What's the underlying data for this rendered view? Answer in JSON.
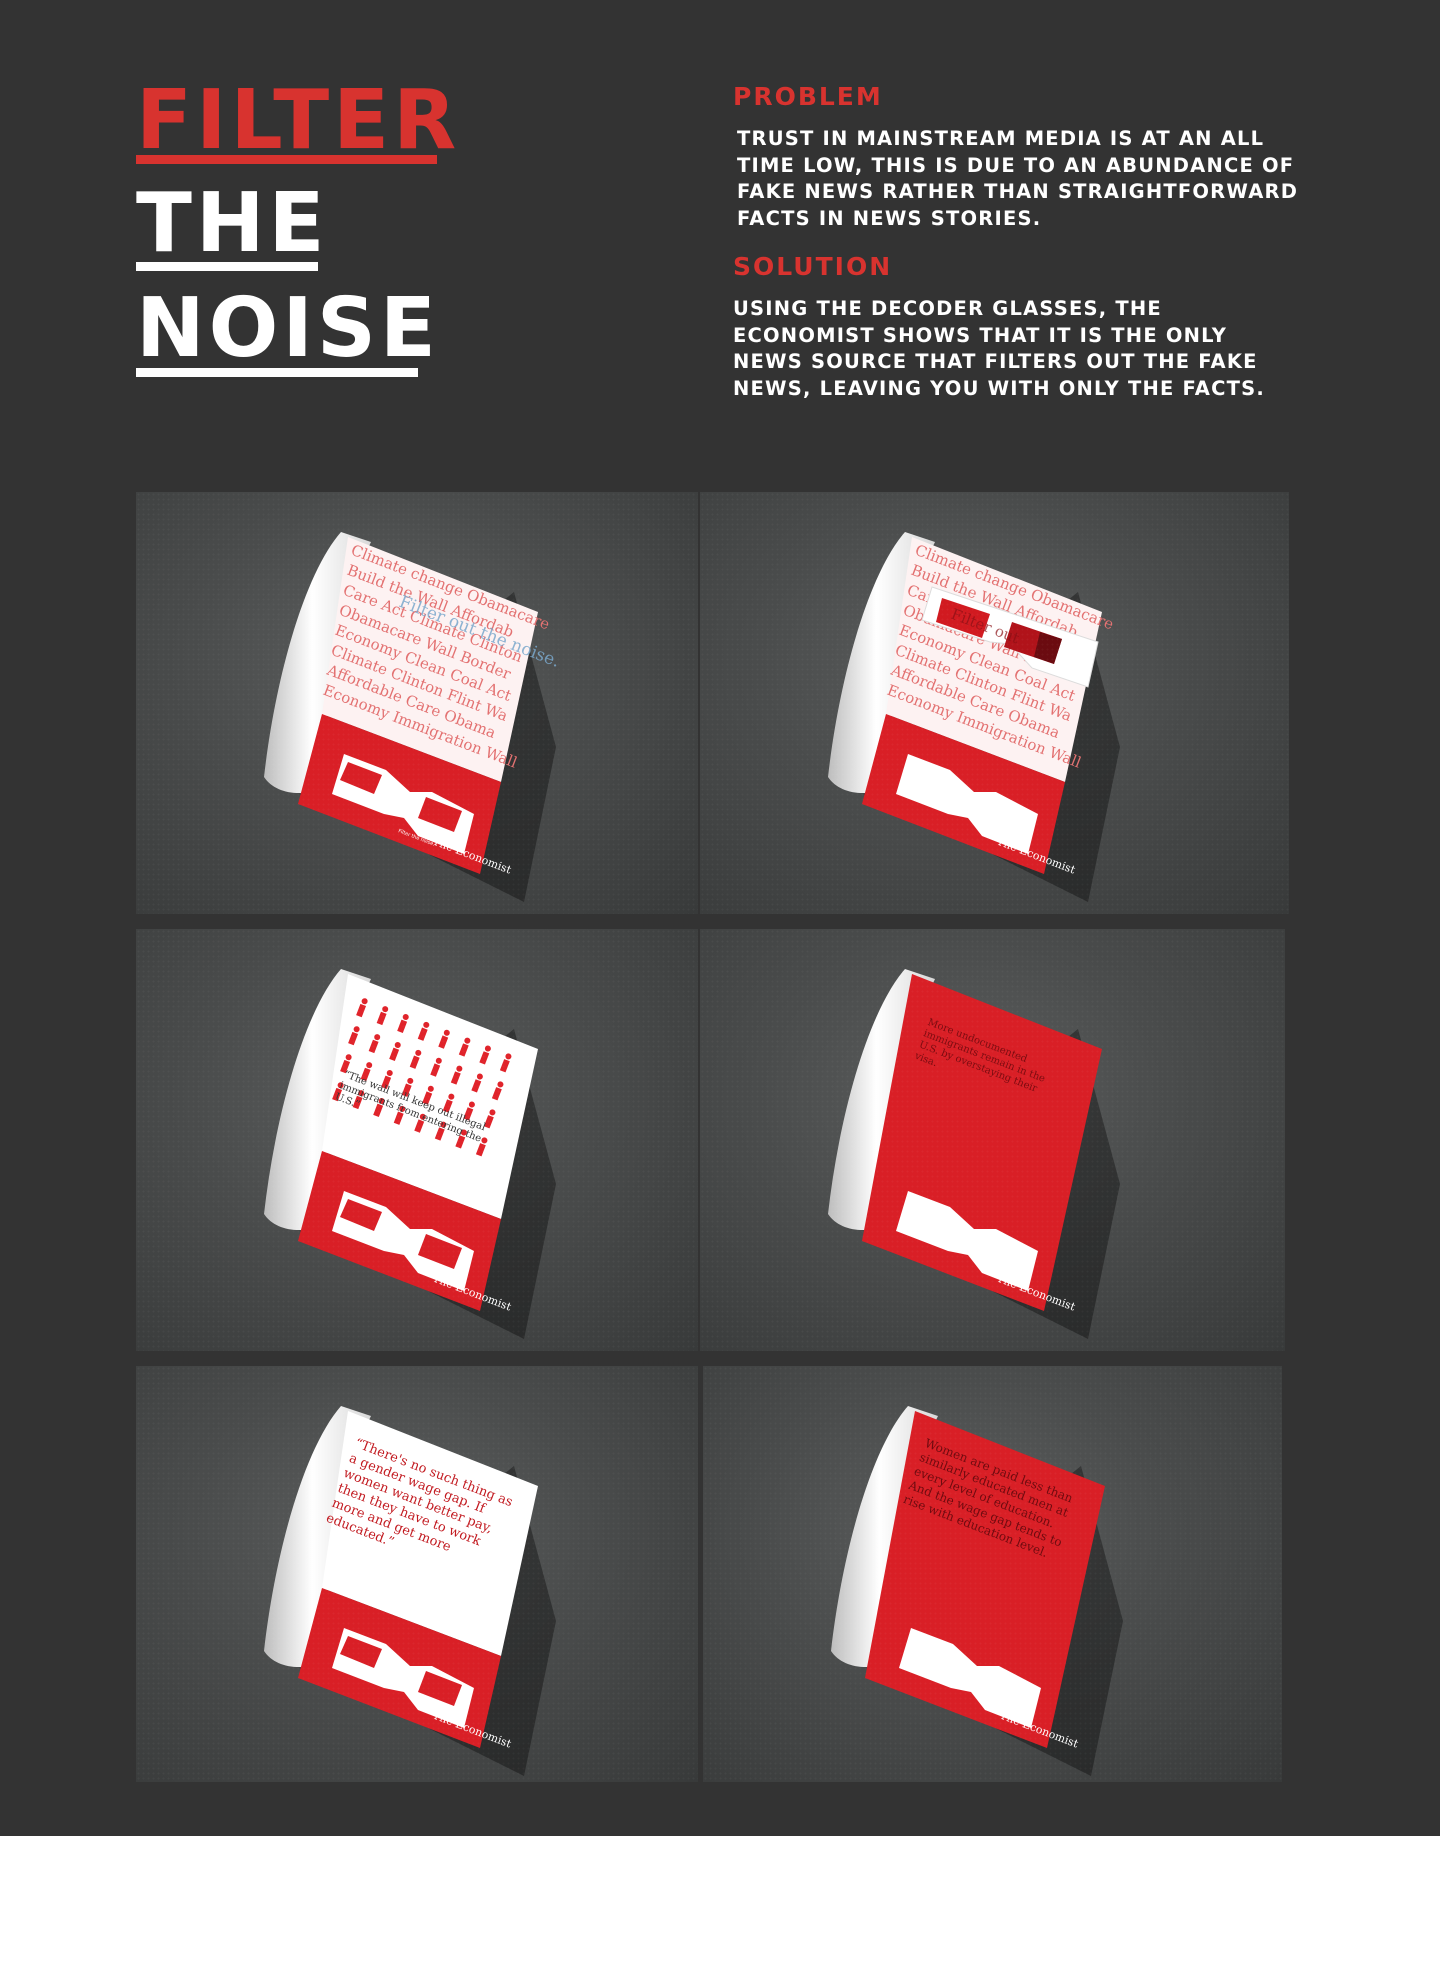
{
  "title": {
    "line1": "FILTER",
    "line2": "THE",
    "line3": "NOISE"
  },
  "problem": {
    "heading": "PROBLEM",
    "text": "TRUST IN MAINSTREAM MEDIA IS AT AN ALL TIME LOW, THIS IS DUE TO AN ABUNDANCE OF FAKE NEWS RATHER THAN STRAIGHTFORWARD FACTS IN NEWS STORIES."
  },
  "solution": {
    "heading": "SOLUTION",
    "text": "USING THE DECODER GLASSES, THE ECONOMIST SHOWS THAT IT IS THE ONLY NEWS SOURCE THAT FILTERS OUT THE FAKE NEWS, LEAVING YOU WITH ONLY THE FACTS."
  },
  "colors": {
    "background": "#333333",
    "accent_red": "#d8332f",
    "text_white": "#ffffff"
  },
  "magazine": {
    "tagline": "Filter the noise.",
    "brand": "The Economist",
    "page1_hidden": "Filter out the noise.",
    "quote_wall": "“The wall will keep out illegal immigrants from entering the U.S.”",
    "fact_wall": "More undocumented immigrants remain in the U.S. by overstaying their visa.",
    "quote_wage": "“There's no such thing as a gender wage gap. If women want better pay, then they have to work more and get more educated.”",
    "fact_wage": "Women are paid less than similarly educated men at every level of education. And the wage gap tends to rise with education level."
  }
}
